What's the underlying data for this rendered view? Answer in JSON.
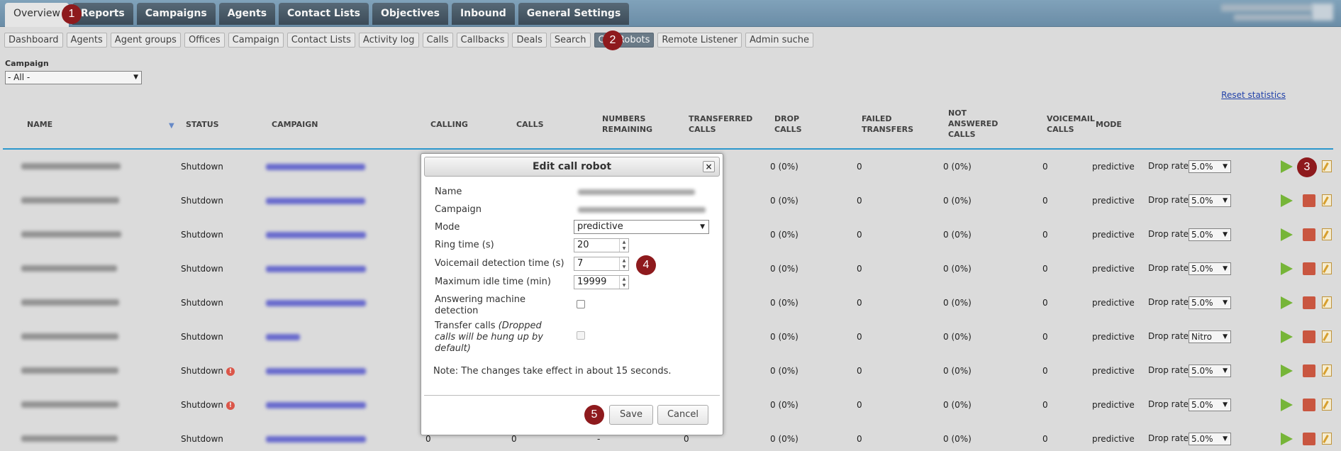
{
  "main_tabs": [
    "Overview",
    "Reports",
    "Campaigns",
    "Agents",
    "Contact Lists",
    "Objectives",
    "Inbound",
    "General Settings"
  ],
  "sub_nav": [
    "Dashboard",
    "Agents",
    "Agent groups",
    "Offices",
    "Campaign",
    "Contact Lists",
    "Activity log",
    "Calls",
    "Callbacks",
    "Deals",
    "Search",
    "Call Robots",
    "Remote Listener",
    "Admin suche"
  ],
  "filter": {
    "label": "Campaign",
    "value": "- All -"
  },
  "reset_label": "Reset statistics",
  "columns": {
    "name": "NAME",
    "status": "STATUS",
    "campaign": "CAMPAIGN",
    "calling": "CALLING",
    "calls": "CALLS",
    "numbers_remaining": [
      "NUMBERS",
      "REMAINING"
    ],
    "transferred_calls": [
      "TRANSFERRED",
      "CALLS"
    ],
    "drop_calls": [
      "DROP",
      "CALLS"
    ],
    "failed_transfers": [
      "FAILED",
      "TRANSFERS"
    ],
    "not_answered_calls": [
      "NOT",
      "ANSWERED",
      "CALLS"
    ],
    "voicemail_calls": [
      "VOICEMAIL",
      "CALLS"
    ],
    "mode": "MODE"
  },
  "drop_rate_label": "Drop rate:",
  "rows": [
    {
      "status": "Shutdown",
      "warn": false,
      "drop": "0 (0%)",
      "failed": "0",
      "not_answered": "0 (0%)",
      "voicemail": "0",
      "mode": "predictive",
      "rate": "5.0%",
      "stop": false
    },
    {
      "status": "Shutdown",
      "warn": false,
      "drop": "0 (0%)",
      "failed": "0",
      "not_answered": "0 (0%)",
      "voicemail": "0",
      "mode": "predictive",
      "rate": "5.0%",
      "stop": true
    },
    {
      "status": "Shutdown",
      "warn": false,
      "drop": "0 (0%)",
      "failed": "0",
      "not_answered": "0 (0%)",
      "voicemail": "0",
      "mode": "predictive",
      "rate": "5.0%",
      "stop": true
    },
    {
      "status": "Shutdown",
      "warn": false,
      "drop": "0 (0%)",
      "failed": "0",
      "not_answered": "0 (0%)",
      "voicemail": "0",
      "mode": "predictive",
      "rate": "5.0%",
      "stop": true
    },
    {
      "status": "Shutdown",
      "warn": false,
      "drop": "0 (0%)",
      "failed": "0",
      "not_answered": "0 (0%)",
      "voicemail": "0",
      "mode": "predictive",
      "rate": "5.0%",
      "stop": true
    },
    {
      "status": "Shutdown",
      "warn": false,
      "drop": "0 (0%)",
      "failed": "0",
      "not_answered": "0 (0%)",
      "voicemail": "0",
      "mode": "predictive",
      "rate": "Nitro",
      "stop": true
    },
    {
      "status": "Shutdown",
      "warn": true,
      "drop": "0 (0%)",
      "failed": "0",
      "not_answered": "0 (0%)",
      "voicemail": "0",
      "mode": "predictive",
      "rate": "5.0%",
      "stop": true
    },
    {
      "status": "Shutdown",
      "warn": true,
      "drop": "0 (0%)",
      "failed": "0",
      "not_answered": "0 (0%)",
      "voicemail": "0",
      "mode": "predictive",
      "rate": "5.0%",
      "stop": true
    },
    {
      "status": "Shutdown",
      "warn": false,
      "calling": "0",
      "calls": "0",
      "remaining": "-",
      "transferred": "0",
      "drop": "0 (0%)",
      "failed": "0",
      "not_answered": "0 (0%)",
      "voicemail": "0",
      "mode": "predictive",
      "rate": "5.0%",
      "stop": true
    }
  ],
  "dialog": {
    "title": "Edit call robot",
    "close": "×",
    "name_label": "Name",
    "campaign_label": "Campaign",
    "mode_label": "Mode",
    "mode_value": "predictive",
    "ring_label": "Ring time (s)",
    "ring_value": "20",
    "voicemail_label": "Voicemail detection time (s)",
    "voicemail_value": "7",
    "idle_label": "Maximum idle time (min)",
    "idle_value": "19999",
    "amd_label": "Answering machine detection",
    "transfer_label": "Transfer calls",
    "transfer_note": "(Dropped calls will be hung up by default)",
    "note": "Note: The changes take effect in about 15 seconds.",
    "save": "Save",
    "cancel": "Cancel"
  },
  "callouts": [
    "1",
    "2",
    "3",
    "4",
    "5"
  ],
  "colors": {
    "accent_line": "#2e9fd6",
    "badge": "#8e1a1d",
    "play": "#7bbd3b",
    "stop": "#d25a43"
  }
}
